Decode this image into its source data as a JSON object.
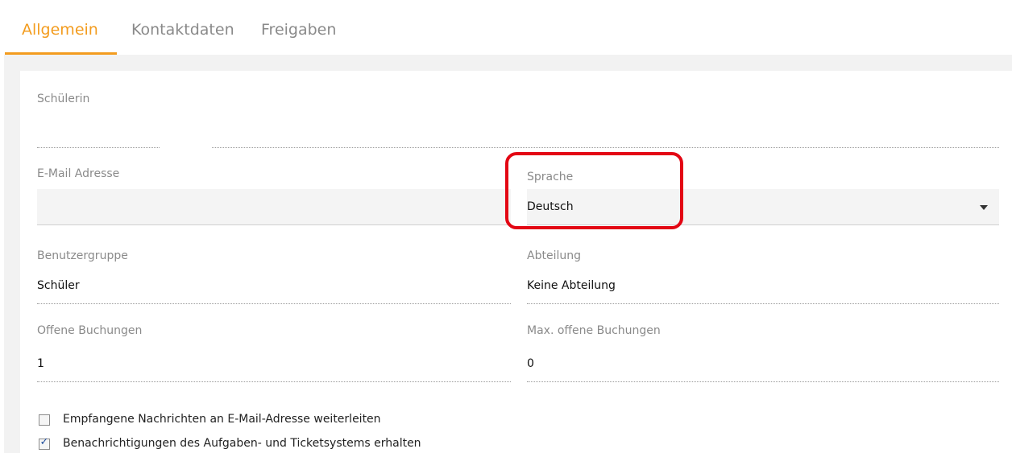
{
  "tabs": [
    {
      "label": "Allgemein",
      "active": true
    },
    {
      "label": "Kontaktdaten",
      "active": false
    },
    {
      "label": "Freigaben",
      "active": false
    }
  ],
  "form": {
    "student_label": "Schülerin",
    "email_label": "E-Mail Adresse",
    "email_value": "",
    "language_label": "Sprache",
    "language_value": "Deutsch",
    "usergroup_label": "Benutzergruppe",
    "usergroup_value": "Schüler",
    "department_label": "Abteilung",
    "department_value": "Keine Abteilung",
    "open_bookings_label": "Offene Buchungen",
    "open_bookings_value": "1",
    "max_open_bookings_label": "Max. offene Buchungen",
    "max_open_bookings_value": "0"
  },
  "checkboxes": [
    {
      "label": "Empfangene Nachrichten an E-Mail-Adresse weiterleiten",
      "checked": false
    },
    {
      "label": "Benachrichtigungen des Aufgaben- und Ticketsystems erhalten",
      "checked": true
    }
  ],
  "colors": {
    "accent": "#f39c1f",
    "highlight": "#e30613"
  },
  "icons": {
    "dropdown": "caret-down-icon",
    "checked": "checkmark-icon"
  }
}
